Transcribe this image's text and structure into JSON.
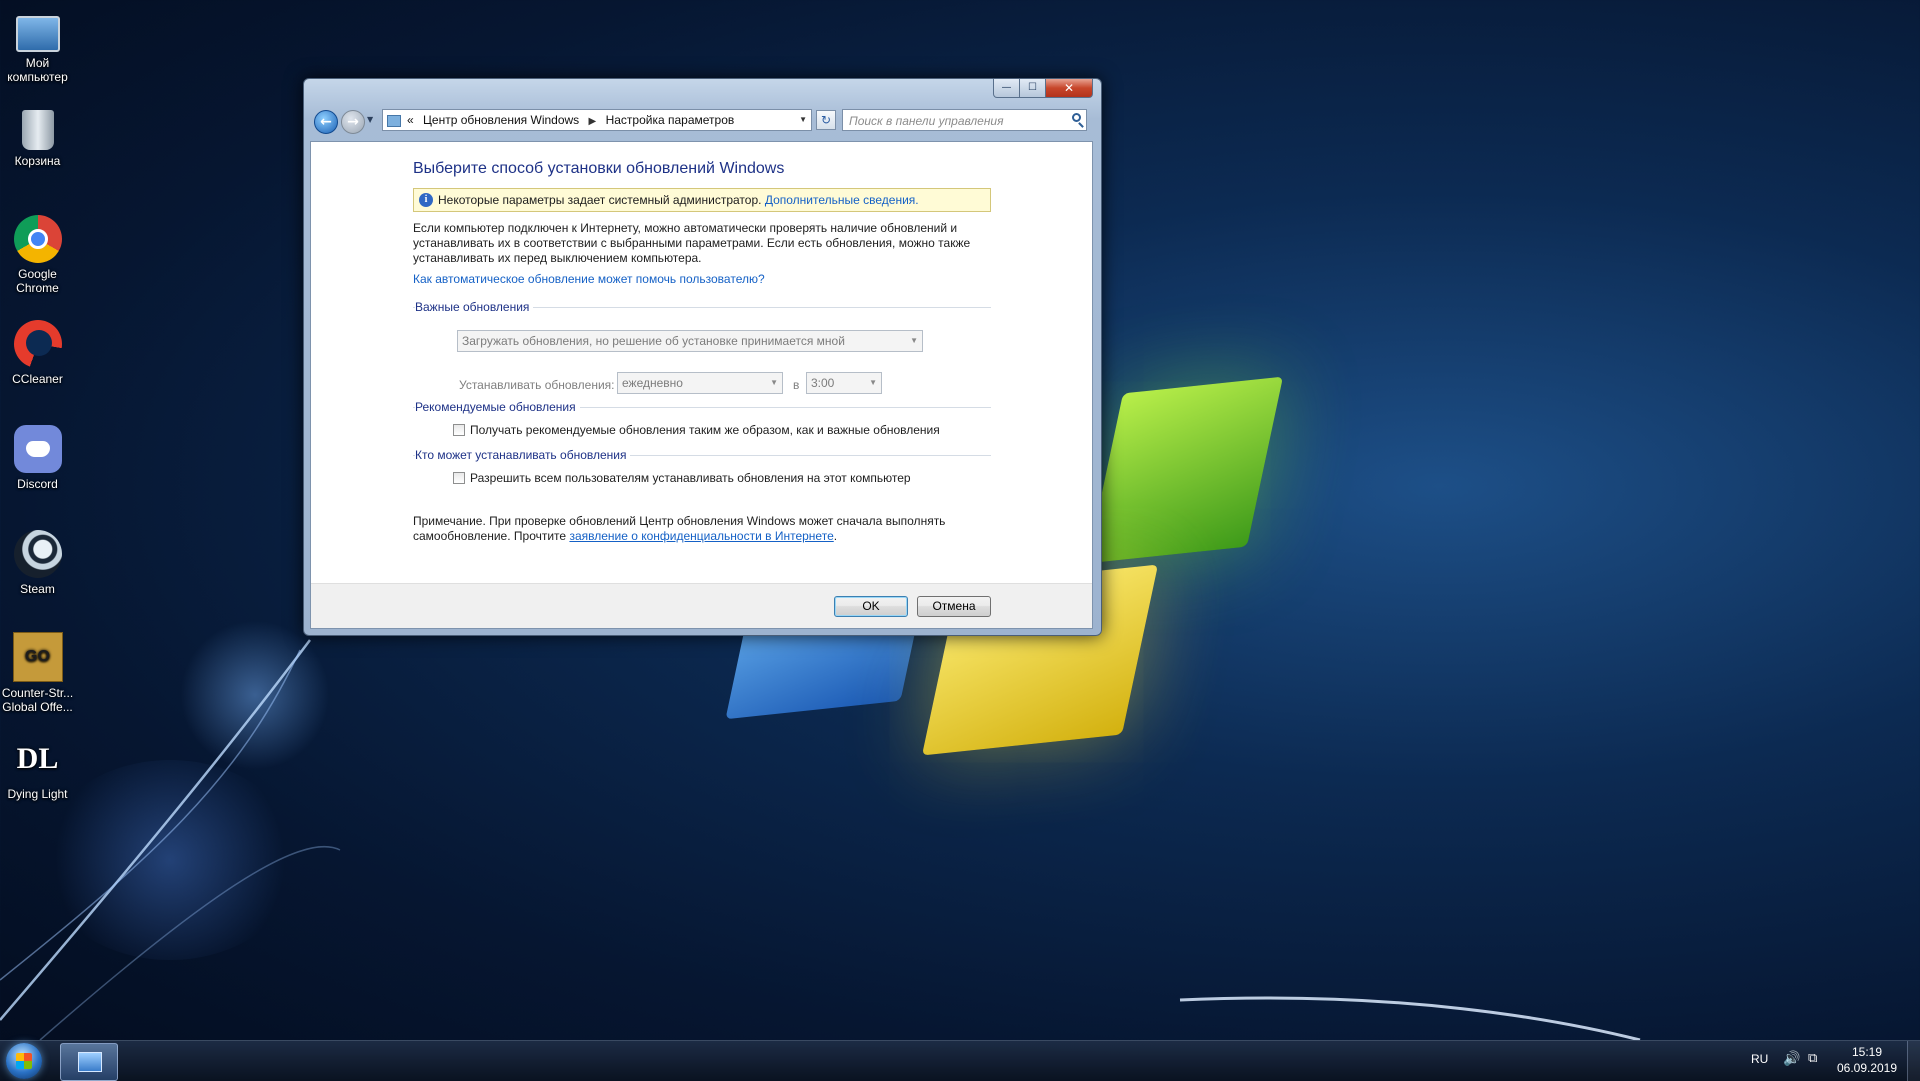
{
  "desktop": {
    "icons": [
      {
        "label_1": "Мой",
        "label_2": "компьютер",
        "icon": "computer-icon"
      },
      {
        "label_1": "Корзина",
        "label_2": "",
        "icon": "recycle-bin-icon"
      },
      {
        "label_1": "Google",
        "label_2": "Chrome",
        "icon": "chrome-icon"
      },
      {
        "label_1": "CCleaner",
        "label_2": "",
        "icon": "ccleaner-icon"
      },
      {
        "label_1": "Discord",
        "label_2": "",
        "icon": "discord-icon"
      },
      {
        "label_1": "Steam",
        "label_2": "",
        "icon": "steam-icon"
      },
      {
        "label_1": "Counter-Str...",
        "label_2": "Global Offe...",
        "icon": "csgo-icon",
        "glyph": "GO"
      },
      {
        "label_1": "Dying Light",
        "label_2": "",
        "icon": "dying-light-icon",
        "glyph": "DL"
      }
    ]
  },
  "window": {
    "controls": {
      "minimize": "—",
      "maximize": "☐",
      "close": "✕"
    },
    "nav": {
      "back_glyph": "←",
      "forward_glyph": "→",
      "dropdown_glyph": "▼"
    },
    "address": {
      "prefix": "«",
      "crumb_1": "Центр обновления Windows",
      "separator": "▶",
      "crumb_2": "Настройка параметров",
      "dropdown_glyph": "▼"
    },
    "refresh_glyph": "↻",
    "search": {
      "placeholder": "Поиск в панели управления"
    },
    "content": {
      "title": "Выберите способ установки обновлений Windows",
      "info": {
        "glyph": "i",
        "text": "Некоторые параметры задает системный администратор.",
        "link": "Дополнительные сведения."
      },
      "description_1": "Если компьютер подключен к Интернету, можно автоматически проверять наличие обновлений и",
      "description_2": "устанавливать их в соответствии с выбранными параметрами. Если есть обновления, можно также",
      "description_3": "устанавливать их перед выключением компьютера.",
      "help_link": "Как автоматическое обновление может помочь пользователю?",
      "important": {
        "heading": "Важные обновления",
        "mode_value": "Загружать обновления, но решение об установке принимается мной",
        "install_label": "Устанавливать обновления:",
        "frequency_value": "ежедневно",
        "at_label": "в",
        "time_value": "3:00"
      },
      "recommended": {
        "heading": "Рекомендуемые обновления",
        "checkbox_label": "Получать рекомендуемые обновления таким же образом, как и важные обновления",
        "checked": false
      },
      "who": {
        "heading": "Кто может устанавливать обновления",
        "checkbox_label": "Разрешить всем пользователям устанавливать обновления на этот компьютер",
        "checked": false
      },
      "note_1": "Примечание. При проверке обновлений Центр обновления Windows может сначала выполнять",
      "note_2_prefix": "самообновление. Прочтите",
      "note_2_link": "заявление о конфиденциальности в Интернете",
      "note_2_suffix": ".",
      "buttons": {
        "ok": "OK",
        "cancel": "Отмена"
      }
    }
  },
  "taskbar": {
    "language": "RU",
    "volume_glyph": "🔊",
    "network_glyph": "⧉",
    "time": "15:19",
    "date": "06.09.2019"
  }
}
